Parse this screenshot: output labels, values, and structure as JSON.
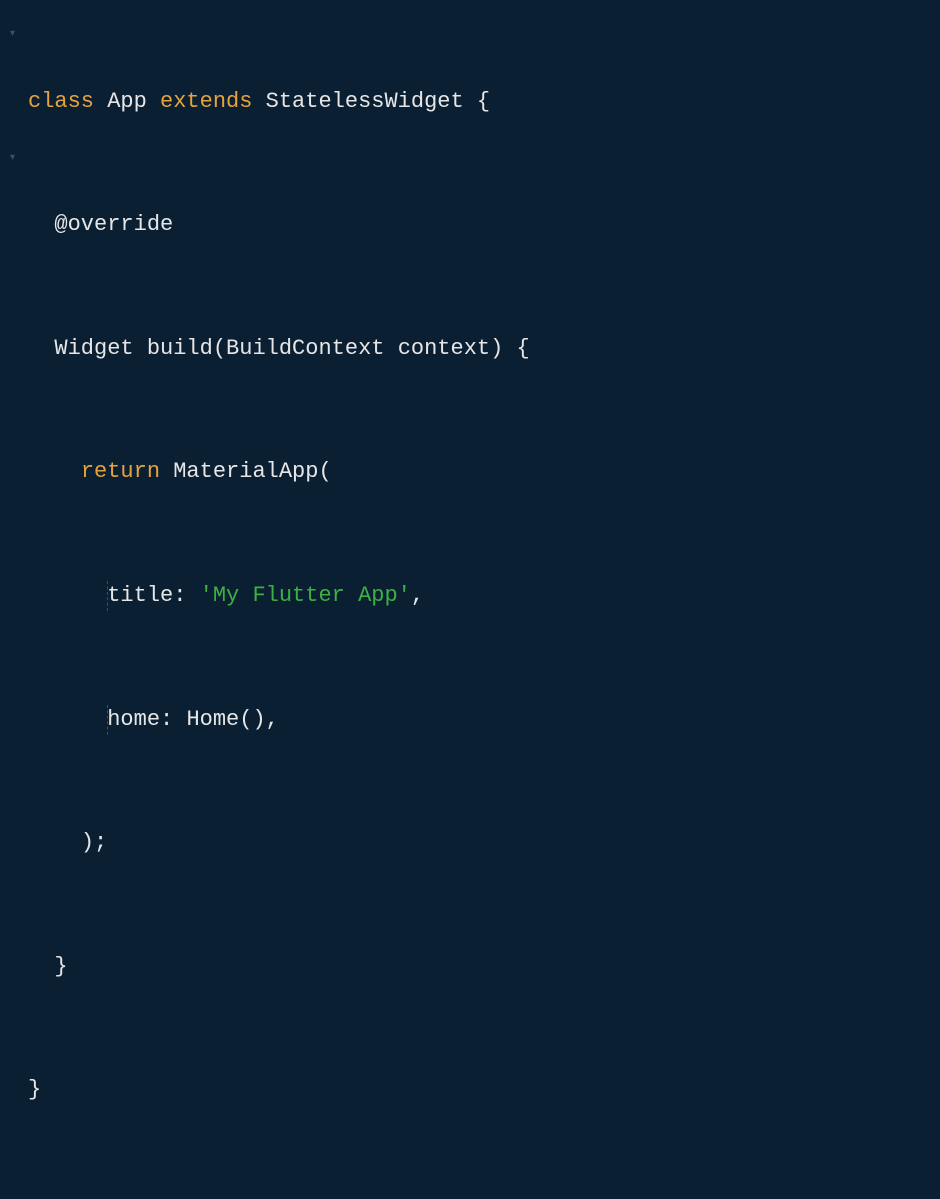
{
  "code": {
    "line1": {
      "kw_class": "class",
      "class_name": "App",
      "kw_extends": "extends",
      "base_class": "StatelessWidget",
      "brace": "{"
    },
    "line2": {
      "annotation": "@override"
    },
    "line3": {
      "return_type": "Widget",
      "method_name": "build",
      "paren_open": "(",
      "param_type": "BuildContext",
      "param_name": "context",
      "paren_close": ")",
      "brace": "{"
    },
    "line4": {
      "kw_return": "return",
      "ctor": "MaterialApp",
      "paren": "("
    },
    "line5": {
      "param": "title",
      "colon": ":",
      "value": "'My Flutter App'",
      "comma": ","
    },
    "line6": {
      "param": "home",
      "colon": ":",
      "ctor": "Home",
      "parens": "()",
      "comma": ","
    },
    "line7": {
      "close": ");"
    },
    "line8": {
      "close": "}"
    },
    "line9": {
      "close": "}"
    }
  },
  "fold_markers": {
    "marker1": "▾",
    "marker2": "▾"
  }
}
